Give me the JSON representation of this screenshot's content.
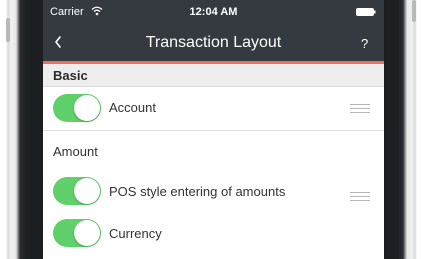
{
  "status_bar": {
    "carrier": "Carrier",
    "time": "12:04 AM",
    "icons": [
      "wifi-icon",
      "battery-icon"
    ]
  },
  "nav_bar": {
    "title": "Transaction Layout",
    "back_icon": "chevron-left-icon",
    "help_label": "?"
  },
  "colors": {
    "nav_background": "#353a40",
    "accent": "#e9705f",
    "toggle_on": "#5fd06a"
  },
  "sections": {
    "basic": {
      "label": "Basic",
      "rows": [
        {
          "label": "Account",
          "toggle_on": true,
          "reorderable": true
        }
      ]
    },
    "amount": {
      "label": "Amount",
      "rows": [
        {
          "label": "POS style entering of amounts",
          "toggle_on": true,
          "reorderable": true
        },
        {
          "label": "Currency",
          "toggle_on": true,
          "reorderable": false
        }
      ]
    }
  }
}
